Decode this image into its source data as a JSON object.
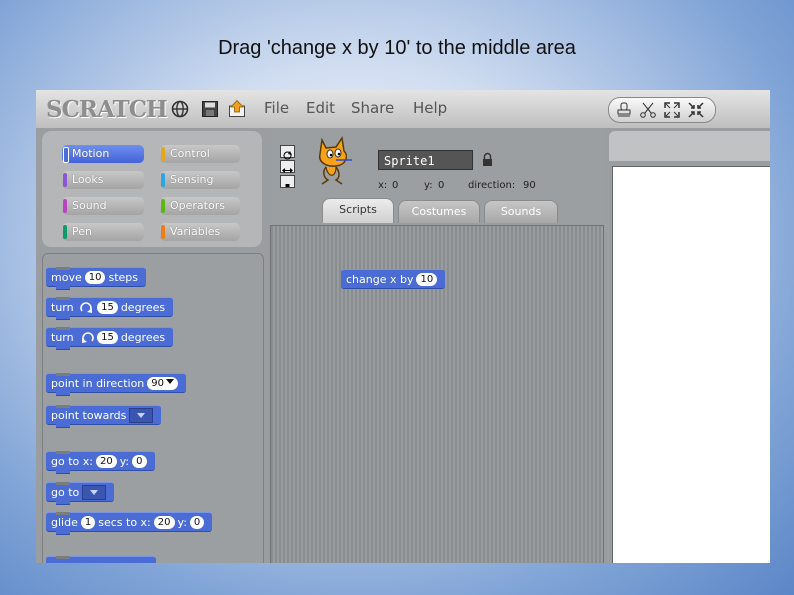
{
  "caption": "Drag 'change x by 10' to the middle area",
  "app": {
    "logo": "SCRATCH",
    "menu": [
      "File",
      "Edit",
      "Share",
      "Help"
    ],
    "categories": {
      "motion": "Motion",
      "control": "Control",
      "looks": "Looks",
      "sensing": "Sensing",
      "sound": "Sound",
      "operators": "Operators",
      "pen": "Pen",
      "variables": "Variables"
    },
    "category_colors": {
      "motion": "#4a6cd4",
      "control": "#e1a91a",
      "looks": "#8a55d7",
      "sensing": "#2ca5e2",
      "sound": "#bb42c3",
      "operators": "#5cb712",
      "pen": "#0e9a6c",
      "variables": "#ee7d16"
    },
    "sprite": {
      "name": "Sprite1",
      "x_label": "x:",
      "x": "0",
      "y_label": "y:",
      "y": "0",
      "direction_label": "direction:",
      "direction": "90"
    },
    "tabs": [
      "Scripts",
      "Costumes",
      "Sounds"
    ],
    "blocks": {
      "move": {
        "a": "move",
        "v": "10",
        "b": "steps"
      },
      "turn_right": {
        "a": "turn",
        "v": "15",
        "b": "degrees"
      },
      "turn_left": {
        "a": "turn",
        "v": "15",
        "b": "degrees"
      },
      "point_dir": {
        "a": "point in direction",
        "v": "90"
      },
      "point_towards": {
        "a": "point towards"
      },
      "goto_xy": {
        "a": "go to x:",
        "v1": "20",
        "b": "y:",
        "v2": "0"
      },
      "goto": {
        "a": "go to"
      },
      "glide": {
        "a": "glide",
        "v1": "1",
        "b": "secs to x:",
        "v2": "20",
        "c": "y:",
        "v3": "0"
      }
    },
    "script_block": {
      "a": "change x by",
      "v": "10"
    }
  }
}
